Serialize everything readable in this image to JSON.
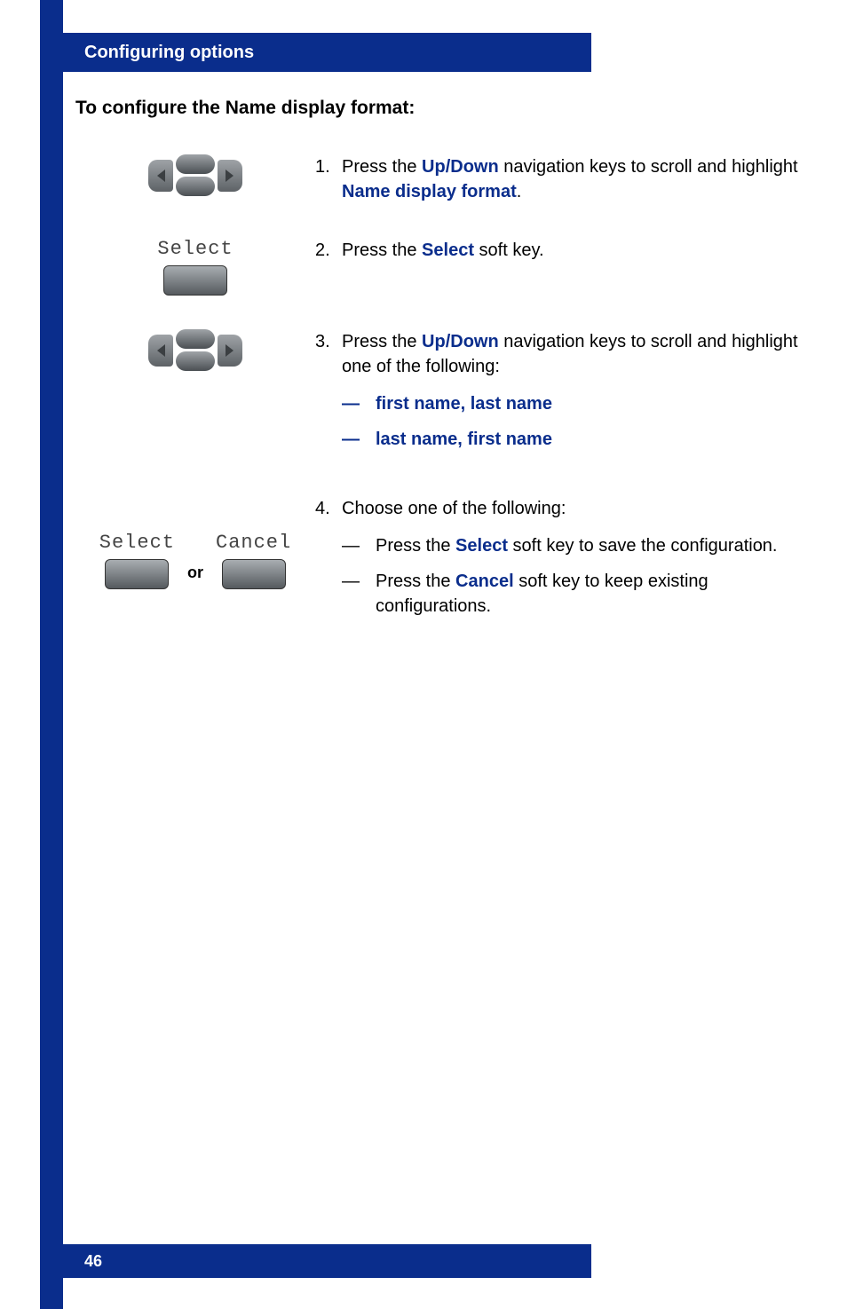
{
  "header": {
    "title": "Configuring options"
  },
  "section_title": "To configure the Name display format:",
  "steps": {
    "s1": {
      "num": "1.",
      "pre": "Press the ",
      "link1": "Up/Down",
      "mid": " navigation keys to scroll and highlight ",
      "link2": "Name display format",
      "post": "."
    },
    "s2": {
      "num": "2.",
      "pre": "Press the ",
      "link": "Select",
      "post": " soft key."
    },
    "s3": {
      "num": "3.",
      "pre": "Press the ",
      "link": "Up/Down",
      "post": " navigation keys to scroll and highlight one of the following:",
      "opt1": "first name, last name",
      "opt2": "last name, first name"
    },
    "s4": {
      "num": "4.",
      "intro": "Choose one of the following:",
      "a_pre": "Press the ",
      "a_link": "Select",
      "a_post": " soft key to save the configuration.",
      "b_pre": "Press the ",
      "b_link": "Cancel",
      "b_post": " soft key to keep existing configurations."
    }
  },
  "softkeys": {
    "select": "Select",
    "cancel": "Cancel",
    "or": "or"
  },
  "footer": {
    "page": "46"
  }
}
